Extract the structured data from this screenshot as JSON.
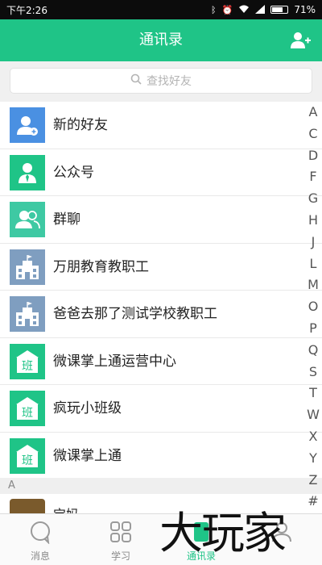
{
  "status": {
    "time": "下午2:26",
    "battery": "71%",
    "battery_level": 0.71,
    "icons": [
      "bluetooth-icon",
      "alarm-icon",
      "wifi-icon",
      "signal-icon",
      "battery-icon"
    ]
  },
  "header": {
    "title": "通讯录",
    "add_icon": "add-friend-icon",
    "color": "#1fc487"
  },
  "search": {
    "placeholder": "查找好友"
  },
  "contacts": [
    {
      "name": "新的好友",
      "icon": "new-friend-icon",
      "color": "#4a90e2"
    },
    {
      "name": "公众号",
      "icon": "official-account-icon",
      "color": "#1fc487"
    },
    {
      "name": "群聊",
      "icon": "group-chat-icon",
      "color": "#3ec9a3"
    },
    {
      "name": "万朋教育教职工",
      "icon": "school-building-icon",
      "color": "#7f9ec0"
    },
    {
      "name": "爸爸去那了测试学校教职工",
      "icon": "school-building-icon",
      "color": "#7f9ec0"
    },
    {
      "name": "微课掌上通运营中心",
      "icon": "class-icon",
      "color": "#1fc487",
      "badge": "班"
    },
    {
      "name": "疯玩小班级",
      "icon": "class-icon",
      "color": "#1fc487",
      "badge": "班"
    },
    {
      "name": "微课掌上通",
      "icon": "class-icon",
      "color": "#1fc487",
      "badge": "班"
    }
  ],
  "section_header": "A",
  "partial_contact": {
    "name": "宝妈"
  },
  "index_letters": [
    "A",
    "C",
    "D",
    "F",
    "G",
    "H",
    "J",
    "L",
    "M",
    "O",
    "P",
    "Q",
    "S",
    "T",
    "W",
    "X",
    "Y",
    "Z",
    "#"
  ],
  "tabs": [
    {
      "label": "消息",
      "icon": "message-icon",
      "active": false
    },
    {
      "label": "学习",
      "icon": "study-grid-icon",
      "active": false
    },
    {
      "label": "通讯录",
      "icon": "contacts-icon",
      "active": true
    },
    {
      "label": "",
      "icon": "profile-icon",
      "active": false
    }
  ],
  "watermark": "大玩家"
}
